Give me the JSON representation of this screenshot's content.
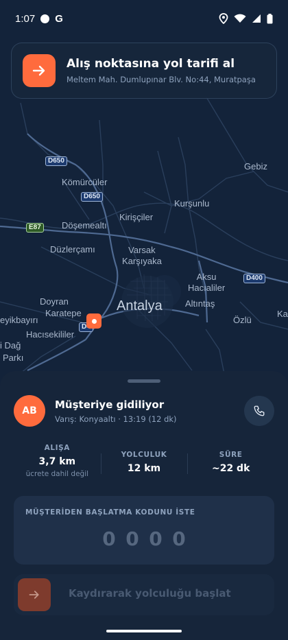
{
  "status_bar": {
    "time": "1:07",
    "g_label": "G"
  },
  "navigation_card": {
    "title": "Alış noktasına yol tarifi al",
    "address": "Meltem Mah. Dumlupınar Blv. No:44, Muratpaşa"
  },
  "map": {
    "places": {
      "gebiz": "Gebiz",
      "komurculer": "Kömürcüler",
      "kursunlu": "Kurşunlu",
      "kiriscler": "Kirişçiler",
      "dosemealti": "Döşemealtı",
      "duzlercami": "Düzlerçamı",
      "varsak": "Varsak\nKarşıyaka",
      "aksu": "Aksu\nHacıaliler",
      "doyran": "Doyran",
      "karatepe": "Karatepe",
      "antalya": "Antalya",
      "altintas": "Altıntaş",
      "eyikbayiri": "eyikbayırı",
      "hacisekililer": "Hacısekililer",
      "ozlu": "Özlü",
      "ka": "Ka",
      "idag": "i Dağ",
      "parki": "Parkı"
    },
    "roads": {
      "d650_a": "D650",
      "d650_b": "D650",
      "e87": "E87",
      "d400": "D400",
      "d4": "D4"
    }
  },
  "trip": {
    "avatar_initials": "AB",
    "status": "Müşteriye gidiliyor",
    "eta": "Varış: Konyaaltı · 13:19 (12 dk)"
  },
  "stats": [
    {
      "label": "ALIŞA",
      "value": "3,7 km",
      "note": "ücrete dahil değil"
    },
    {
      "label": "YOLCULUK",
      "value": "12 km"
    },
    {
      "label": "SÜRE",
      "value": "~22 dk"
    }
  ],
  "code": {
    "label": "MÜŞTERİDEN BAŞLATMA KODUNU İSTE",
    "digits": [
      "0",
      "0",
      "0",
      "0"
    ]
  },
  "slider": {
    "label": "Kaydırarak yolculuğu başlat"
  },
  "colors": {
    "accent": "#ff6b3d",
    "background": "#0e1a2b",
    "sheet": "#16253a"
  }
}
